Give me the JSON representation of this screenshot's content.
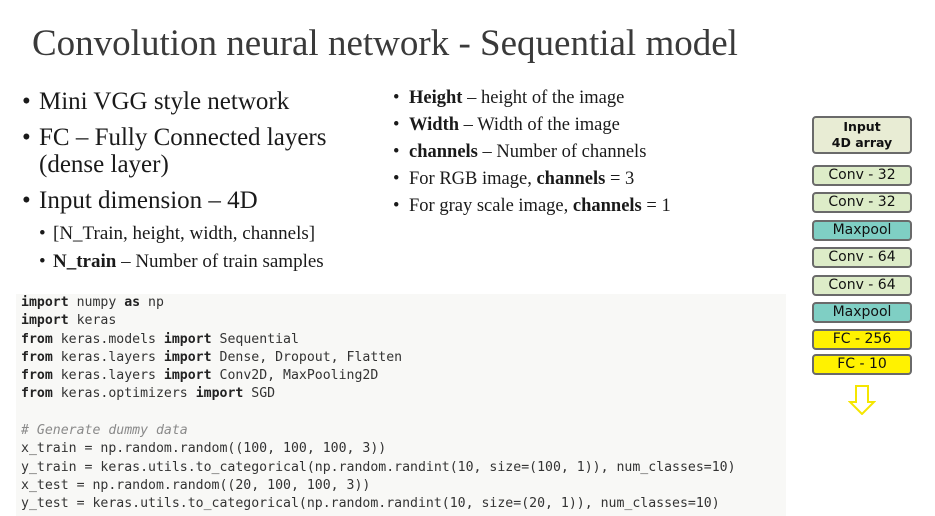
{
  "title": "Convolution neural network - Sequential model",
  "left_bullets": {
    "b1": "Mini VGG style network",
    "b2": "FC – Fully Connected layers (dense layer)",
    "b3": "Input dimension – 4D",
    "sub1": "[N_Train, height, width, channels]",
    "sub2_term": "N_train",
    "sub2_desc": " – Number of train samples"
  },
  "right_bullets": [
    {
      "term": "Height",
      "desc": " – height of the image"
    },
    {
      "term": "Width",
      "desc": " – Width of the image"
    },
    {
      "term": "channels",
      "desc": " – Number of channels"
    },
    {
      "pre": "For RGB image, ",
      "term": "channels",
      "post": " = 3"
    },
    {
      "pre": "For gray scale image, ",
      "term": "channels",
      "post": " = 1"
    }
  ],
  "code": {
    "l1": {
      "kw1": "import",
      "rest": " numpy ",
      "kw2": "as",
      "rest2": " np"
    },
    "l2": {
      "kw1": "import",
      "rest": " keras"
    },
    "l3": {
      "kw1": "from",
      "mod": " keras.models ",
      "kw2": "import",
      "rest": " Sequential"
    },
    "l4": {
      "kw1": "from",
      "mod": " keras.layers ",
      "kw2": "import",
      "rest": " Dense, Dropout, Flatten"
    },
    "l5": {
      "kw1": "from",
      "mod": " keras.layers ",
      "kw2": "import",
      "rest": " Conv2D, MaxPooling2D"
    },
    "l6": {
      "kw1": "from",
      "mod": " keras.optimizers ",
      "kw2": "import",
      "rest": " SGD"
    },
    "comment": "# Generate dummy data",
    "l8": "x_train = np.random.random((100, 100, 100, 3))",
    "l9": "y_train = keras.utils.to_categorical(np.random.randint(10, size=(100, 1)), num_classes=10)",
    "l10": "x_test = np.random.random((20, 100, 100, 3))",
    "l11": "y_test = keras.utils.to_categorical(np.random.randint(10, size=(20, 1)), num_classes=10)"
  },
  "layers": [
    {
      "label": "Input\n4D array",
      "color": "#e8ecd4"
    },
    {
      "label": "Conv - 32",
      "color": "#ddecc8"
    },
    {
      "label": "Conv - 32",
      "color": "#ddecc8"
    },
    {
      "label": "Maxpool",
      "color": "#7fcfc4"
    },
    {
      "label": "Conv - 64",
      "color": "#ddecc8"
    },
    {
      "label": "Conv - 64",
      "color": "#ddecc8"
    },
    {
      "label": "Maxpool",
      "color": "#7fcfc4"
    },
    {
      "label": "FC - 256",
      "color": "#fff200"
    },
    {
      "label": "FC - 10",
      "color": "#fff200"
    }
  ],
  "arrow_color": "#f5e600"
}
